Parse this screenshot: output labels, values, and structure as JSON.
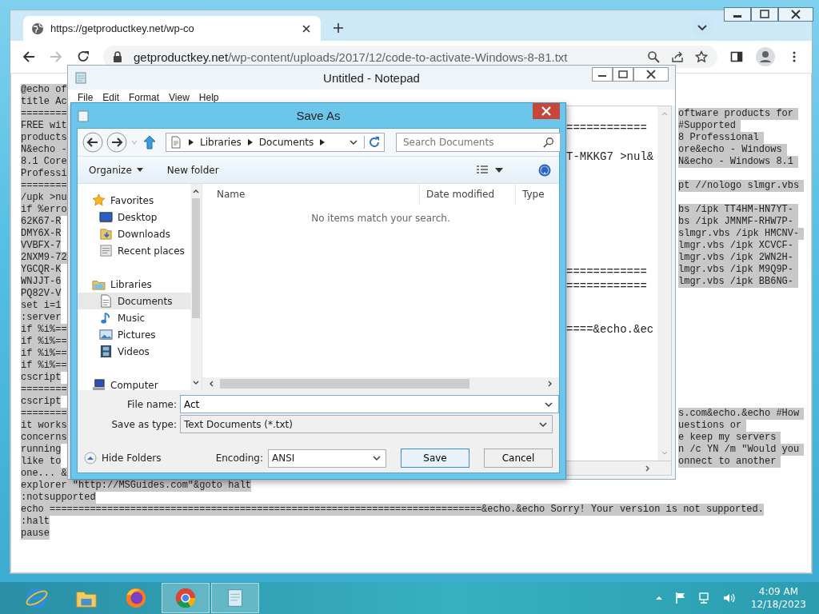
{
  "browser": {
    "tabs": [
      {
        "title": "https://getproductkey.net/wp-co",
        "selected": true
      }
    ],
    "nav_buttons": [
      {
        "kind": "back",
        "disabled": false
      },
      {
        "kind": "forward",
        "disabled": true
      },
      {
        "kind": "reload",
        "disabled": false
      }
    ],
    "url": {
      "host": "getproductkey.net",
      "path": "/wp-content/uploads/2017/12/code-to-activate-Windows-8-81.txt"
    },
    "lines": [
      {
        "left": "@echo of"
      },
      {
        "left": "title Ac"
      },
      {
        "left": "========",
        "right": "oftware products for"
      },
      {
        "left": "FREE wit",
        "right": "#Supported"
      },
      {
        "left": "products",
        "right": "8 Professional"
      },
      {
        "left": "N&echo -",
        "right": "ore&echo - Windows"
      },
      {
        "left": "8.1 Core",
        "right": "N&echo - Windows 8.1"
      },
      {
        "left": "Professi"
      },
      {
        "left": "========",
        "right": "pt //nologo slmgr.vbs"
      },
      {
        "left": "/upk >nu"
      },
      {
        "left": "if %erro",
        "right": "bs /ipk TT4HM-HN7YT-"
      },
      {
        "left": "62K67-R",
        "right": "bs /ipk JMNMF-RHW7P-"
      },
      {
        "left": "DMY6X-R",
        "right": "slmgr.vbs /ipk HMCNV-"
      },
      {
        "left": "VVBFX-7",
        "right": "lmgr.vbs /ipk XCVCF-"
      },
      {
        "left": "2NXM9-72",
        "right": "lmgr.vbs /ipk 2WN2H-"
      },
      {
        "left": "YGCQR-K",
        "right": "lmgr.vbs /ipk M9Q9P-"
      },
      {
        "left": "WNJJT-6",
        "right": "lmgr.vbs /ipk BB6NG-"
      },
      {
        "left": "PQ82V-V"
      },
      {
        "left": "set i=1"
      },
      {
        "left": ":server"
      },
      {
        "left": "if %i%=="
      },
      {
        "left": "if %i%=="
      },
      {
        "left": "if %i%=="
      },
      {
        "left": "if %i%=="
      },
      {
        "left": "cscript"
      },
      {
        "left": "========"
      },
      {
        "left": "cscript"
      },
      {
        "left": "========",
        "right": "s.com&echo.&echo #How"
      },
      {
        "left": "it works",
        "right": "uestions or"
      },
      {
        "left": "concerns",
        "right": "e keep my servers"
      },
      {
        "left": "running",
        "right": "n /c YN /m \"Would you"
      },
      {
        "left": "like to",
        "right": "onnect to another"
      },
      {
        "left": "one... &"
      },
      {
        "left": "explorer \"http://MSGuides.com\"&goto halt"
      },
      {
        "left": ":notsupported"
      },
      {
        "left": "echo ===========================================================================&echo.&echo Sorry! Your version is not supported."
      },
      {
        "left": ":halt"
      },
      {
        "left": "pause"
      }
    ]
  },
  "notepad": {
    "title": "Untitled - Notepad",
    "menu": [
      "File",
      "Edit",
      "Format",
      "View",
      "Help"
    ],
    "lines": [
      "============",
      "T-MKKG7 >nul&",
      "============",
      "============",
      "====&echo.&ec"
    ]
  },
  "dialog": {
    "title": "Save As",
    "path": [
      "Libraries",
      "Documents"
    ],
    "search": {
      "placeholder": "Search Documents"
    },
    "toolbar": [
      "Organize",
      "New folder"
    ],
    "tree": [
      {
        "label": "Favorites",
        "kind": "star",
        "selected": false,
        "children": [
          {
            "label": "Desktop",
            "kind": "desktop",
            "selected": false
          },
          {
            "label": "Downloads",
            "kind": "downloads",
            "selected": false
          },
          {
            "label": "Recent places",
            "kind": "recent",
            "selected": false
          }
        ]
      },
      {
        "label": "Libraries",
        "kind": "library",
        "selected": false,
        "children": [
          {
            "label": "Documents",
            "kind": "document",
            "selected": true
          },
          {
            "label": "Music",
            "kind": "music",
            "selected": false
          },
          {
            "label": "Pictures",
            "kind": "pictures",
            "selected": false
          },
          {
            "label": "Videos",
            "kind": "videos",
            "selected": false
          }
        ]
      },
      {
        "label": "Computer",
        "kind": "computer",
        "selected": false
      }
    ],
    "columns": [
      "Name",
      "Date modified",
      "Type"
    ],
    "empty_message": "No items match your search.",
    "file_name": {
      "label": "File name:",
      "value": "Act"
    },
    "save_type": {
      "label": "Save as type:",
      "value": "Text Documents (*.txt)"
    },
    "hide_folders": "Hide Folders",
    "encoding": {
      "label": "Encoding:",
      "value": "ANSI"
    },
    "buttons": [
      "Save",
      "Cancel"
    ]
  },
  "taskbar": {
    "apps": [
      {
        "kind": "ie",
        "running": false
      },
      {
        "kind": "explorer",
        "running": false
      },
      {
        "kind": "firefox",
        "running": false
      },
      {
        "kind": "chrome",
        "running": true
      },
      {
        "kind": "notepad",
        "running": true
      }
    ],
    "time": "4:09 AM",
    "date": "12/18/2023"
  }
}
